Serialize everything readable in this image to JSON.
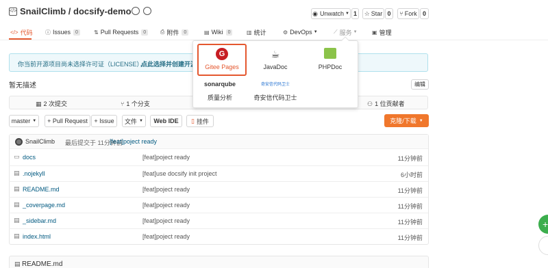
{
  "repo": {
    "title": "SnailClimb / docsify-demo"
  },
  "header_actions": {
    "watch": {
      "label": "Unwatch",
      "count": "1"
    },
    "star": {
      "label": "Star",
      "count": "0"
    },
    "fork": {
      "label": "Fork",
      "count": "0"
    }
  },
  "tabs": [
    {
      "label": "代码",
      "badge": ""
    },
    {
      "label": "Issues",
      "badge": "0"
    },
    {
      "label": "Pull Requests",
      "badge": "0"
    },
    {
      "label": "附件",
      "badge": "0"
    },
    {
      "label": "Wiki",
      "badge": "0"
    },
    {
      "label": "统计",
      "badge": ""
    },
    {
      "label": "DevOps",
      "badge": ""
    },
    {
      "label": "服务",
      "badge": ""
    },
    {
      "label": "管理",
      "badge": ""
    }
  ],
  "notice": {
    "text": "你当前开源项目尚未选择许可证（LICENSE），",
    "link": "点此选择并创建开源"
  },
  "description": {
    "text": "暂无描述",
    "edit": "编辑"
  },
  "stats": {
    "commits": "2 次提交",
    "branches": "1 个分支",
    "contributors": "1 位贡献者"
  },
  "toolbar": {
    "branch": "master",
    "pull_request": "+ Pull Request",
    "issue": "+ Issue",
    "files": "文件",
    "webide": "Web IDE",
    "mount": "挂件",
    "clone": "克隆/下载"
  },
  "commit_bar": {
    "user": "SnailClimb",
    "time_text": "最后提交于 11分钟前",
    "message": "[feat]poject ready"
  },
  "files": [
    {
      "name": "docs",
      "type": "folder",
      "message": "[feat]poject ready",
      "time": "11分钟前"
    },
    {
      "name": ".nojekyll",
      "type": "file",
      "message": "[feat]use docsify init project",
      "time": "6小时前"
    },
    {
      "name": "README.md",
      "type": "file",
      "message": "[feat]poject ready",
      "time": "11分钟前"
    },
    {
      "name": "_coverpage.md",
      "type": "file",
      "message": "[feat]poject ready",
      "time": "11分钟前"
    },
    {
      "name": "_sidebar.md",
      "type": "file",
      "message": "[feat]poject ready",
      "time": "11分钟前"
    },
    {
      "name": "index.html",
      "type": "file",
      "message": "[feat]poject ready",
      "time": "11分钟前"
    }
  ],
  "readme": {
    "title": "README.md"
  },
  "services_menu": {
    "items": [
      {
        "label": "Gitee Pages"
      },
      {
        "label": "JavaDoc"
      },
      {
        "label": "PHPDoc"
      },
      {
        "label": "质量分析",
        "logo": "sonarqube"
      },
      {
        "label": "奇安信代码卫士",
        "logo": "奇安信代码卫士"
      }
    ]
  },
  "colors": {
    "accent": "#e4572e",
    "link": "#005980",
    "notice_bg": "#eef8fb",
    "notice_border": "#aee0ec",
    "clone": "#f0772c"
  }
}
